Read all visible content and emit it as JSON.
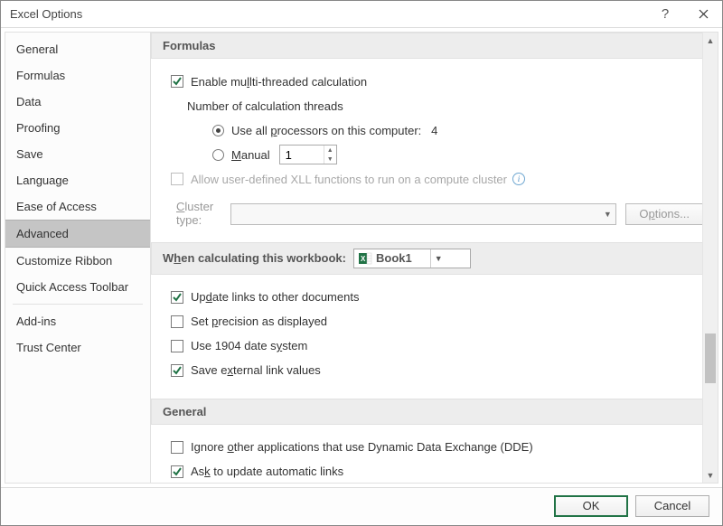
{
  "window": {
    "title": "Excel Options"
  },
  "sidebar": {
    "items": [
      {
        "label": "General"
      },
      {
        "label": "Formulas"
      },
      {
        "label": "Data"
      },
      {
        "label": "Proofing"
      },
      {
        "label": "Save"
      },
      {
        "label": "Language"
      },
      {
        "label": "Ease of Access"
      },
      {
        "label": "Advanced",
        "selected": true
      },
      {
        "label": "Customize Ribbon"
      },
      {
        "label": "Quick Access Toolbar"
      },
      {
        "label": "Add-ins"
      },
      {
        "label": "Trust Center"
      }
    ]
  },
  "groups": {
    "formulas": {
      "header": "Formulas",
      "enable_multi": "lti-threaded calculation",
      "enable_multi_prefix": "Enable mu",
      "threads_label": "Number of calculation threads",
      "use_all_prefix": "Use all ",
      "use_all_mid": "rocessors on this computer:",
      "processor_count": "4",
      "manual_prefix": "",
      "manual_label": "anual",
      "manual_value": "1",
      "allow_xll": "Allow user-defined XLL functions to run on a compute cluster",
      "cluster_label": "Cluster type:",
      "options_btn": "Options..."
    },
    "workbook": {
      "header_prefix": "W",
      "header_rest": "en calculating this workbook:",
      "selected": "Book1",
      "update_links_pre": "Up",
      "update_links_post": "ate links to other documents",
      "precision_pre": "Set ",
      "precision_post": "recision as displayed",
      "date1904_pre": "Use 1904 date s",
      "date1904_post": "stem",
      "save_ext_pre": "Save e",
      "save_ext_post": "ternal link values"
    },
    "general": {
      "header": "General",
      "ignore_dde_pre": "Ignore ",
      "ignore_dde_post": "ther applications that use Dynamic Data Exchange (DDE)",
      "ask_update_pre": "As",
      "ask_update_post": " to update automatic links"
    }
  },
  "footer": {
    "ok": "OK",
    "cancel": "Cancel"
  }
}
